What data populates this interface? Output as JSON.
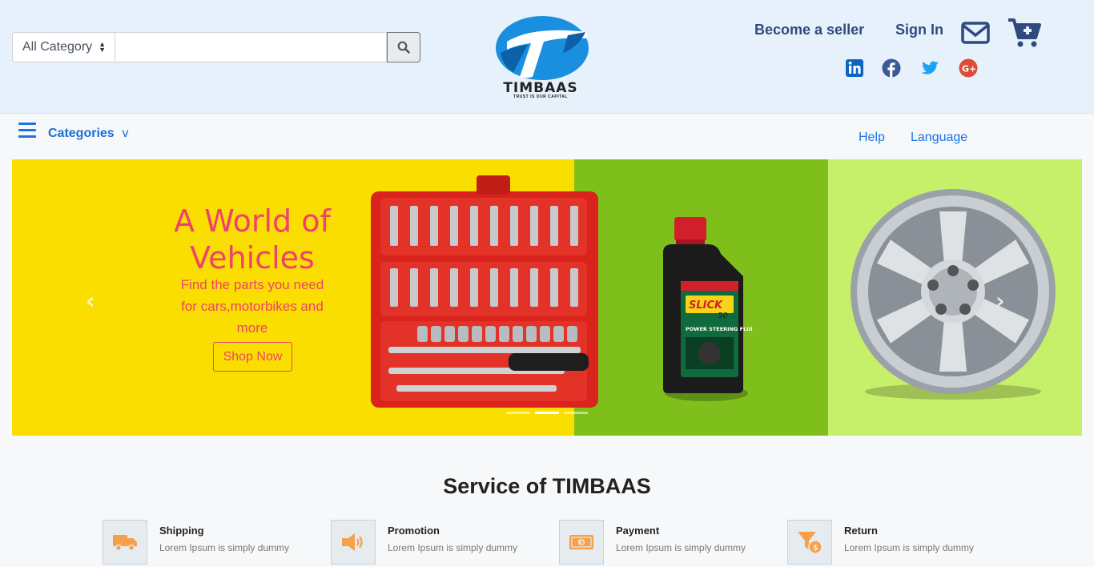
{
  "header": {
    "category_select": "All Category",
    "search_value": "",
    "logo_text": "TIMBAAS",
    "logo_tagline": "TRUST IS OUR CAPITAL",
    "become_seller": "Become a seller",
    "sign_in": "Sign In",
    "icons": [
      "mail-icon",
      "cart-plus-icon",
      "linkedin-icon",
      "facebook-icon",
      "twitter-icon",
      "google-plus-icon"
    ]
  },
  "nav": {
    "categories": "Categories",
    "caret": "v",
    "help": "Help",
    "language": "Language"
  },
  "hero": {
    "title": "A World of Vehicles",
    "subtitle": "Find the parts you need for cars,motorbikes and more",
    "cta": "Shop Now",
    "slide_count": 3,
    "active_slide": 2,
    "bottle_brand": "SLICK",
    "bottle_brand_num": "50",
    "bottle_label": "POWER STEERING FLUID"
  },
  "services": {
    "title": "Service of TIMBAAS",
    "items": [
      {
        "name": "Shipping",
        "desc": "Lorem Ipsum is simply dummy",
        "icon": "truck-icon"
      },
      {
        "name": "Promotion",
        "desc": "Lorem Ipsum is simply dummy",
        "icon": "megaphone-icon"
      },
      {
        "name": "Payment",
        "desc": "Lorem Ipsum is simply dummy",
        "icon": "money-bill-icon"
      },
      {
        "name": "Return",
        "desc": "Lorem Ipsum is simply dummy",
        "icon": "filter-dollar-icon"
      }
    ]
  },
  "colors": {
    "header_bg": "#e6f1fb",
    "link_blue": "#1a73e8",
    "hero_yellow": "#fade00",
    "hero_green": "#7fbf1c",
    "hero_lime": "#c6f06a",
    "hero_pink": "#f0416e",
    "service_orange": "#f5a04a"
  }
}
